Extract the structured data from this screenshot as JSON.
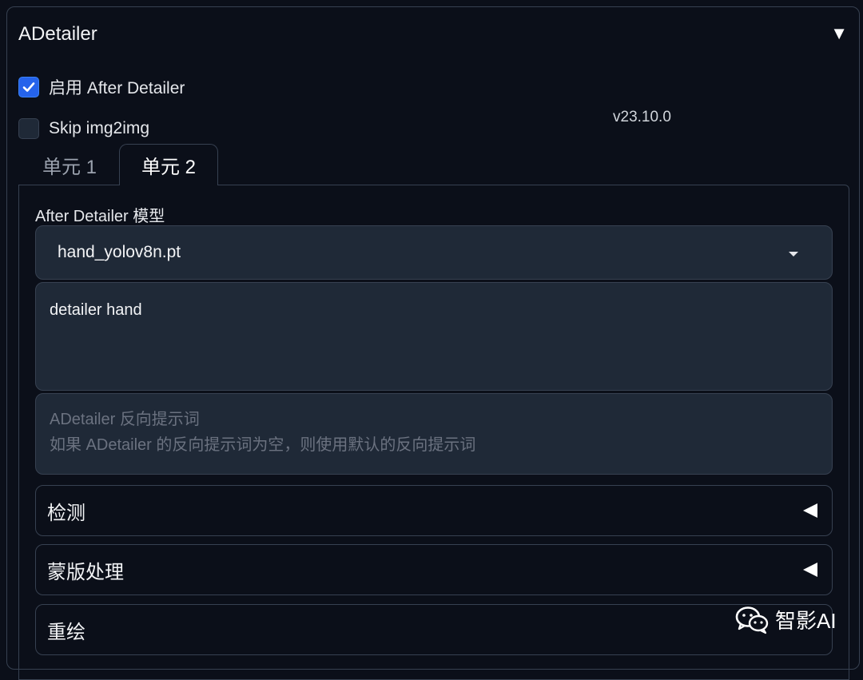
{
  "adetailer": {
    "title": "ADetailer",
    "collapse_glyph": "▼",
    "enable_label": "启用 After Detailer",
    "enable_checked": true,
    "skip_label": "Skip img2img",
    "skip_checked": false,
    "version": "v23.10.0"
  },
  "tabs": [
    {
      "label": "单元 1",
      "active": false
    },
    {
      "label": "单元 2",
      "active": true
    }
  ],
  "unit": {
    "model_label": "After Detailer 模型",
    "model_value": "hand_yolov8n.pt",
    "prompt_value": "detailer hand",
    "negative_placeholder_line1": "ADetailer 反向提示词",
    "negative_placeholder_line2": "如果 ADetailer 的反向提示词为空，则使用默认的反向提示词",
    "accordions": [
      {
        "label": "检测",
        "icon": "triangle-left-icon"
      },
      {
        "label": "蒙版处理",
        "icon": "triangle-left-icon"
      },
      {
        "label": "重绘",
        "icon": "triangle-left-icon"
      }
    ]
  },
  "watermark": {
    "icon": "wechat-icon",
    "text": "智影AI"
  },
  "colors": {
    "background": "#0b0f19",
    "input_bg": "#1f2937",
    "border": "#374151",
    "accent": "#2563eb"
  }
}
